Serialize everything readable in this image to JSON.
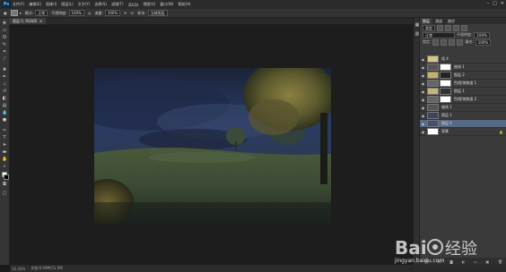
{
  "app": {
    "logo": "Ps"
  },
  "menu": [
    "文件(F)",
    "编辑(E)",
    "图像(I)",
    "图层(L)",
    "文字(Y)",
    "选择(S)",
    "滤镜(T)",
    "3D(D)",
    "视图(V)",
    "窗口(W)",
    "帮助(H)"
  ],
  "window_controls": [
    "–",
    "□",
    "✕"
  ],
  "options": {
    "mode_label": "模式:",
    "mode_value": "正常",
    "opacity_label": "不透明度:",
    "opacity_value": "100%",
    "flow_label": "流量:",
    "flow_value": "100%",
    "sample_label": "样本:",
    "sample_value": "当前图层"
  },
  "document": {
    "tab_title": "图层 0, RGB/8",
    "tab_close": "✕"
  },
  "status": {
    "zoom": "33.33%",
    "doc_info": "文档:6.09M/31.5M"
  },
  "layers_panel": {
    "tabs": [
      "图层",
      "通道",
      "路径"
    ],
    "kind_label": "类型",
    "blend_mode": "正常",
    "opacity_label": "不透明度:",
    "opacity_value": "100%",
    "lock_label": "锁定:",
    "fill_label": "填充:",
    "fill_value": "100%",
    "layers": [
      {
        "name": "组 4"
      },
      {
        "name": "曲线 1"
      },
      {
        "name": "图层 2"
      },
      {
        "name": "色相/饱和度 1"
      },
      {
        "name": "图层 1"
      },
      {
        "name": "色相/饱和度 2"
      },
      {
        "name": "曲线 1"
      },
      {
        "name": "图层 1"
      },
      {
        "name": "图层 0"
      },
      {
        "name": "背景"
      }
    ],
    "footer_icons": [
      "link-icon",
      "fx-icon",
      "mask-icon",
      "adjustment-icon",
      "folder-icon",
      "new-layer-icon",
      "trash-icon"
    ]
  },
  "watermark": {
    "brand": "Bai 经验",
    "site": "jingyan.baidu.com"
  }
}
